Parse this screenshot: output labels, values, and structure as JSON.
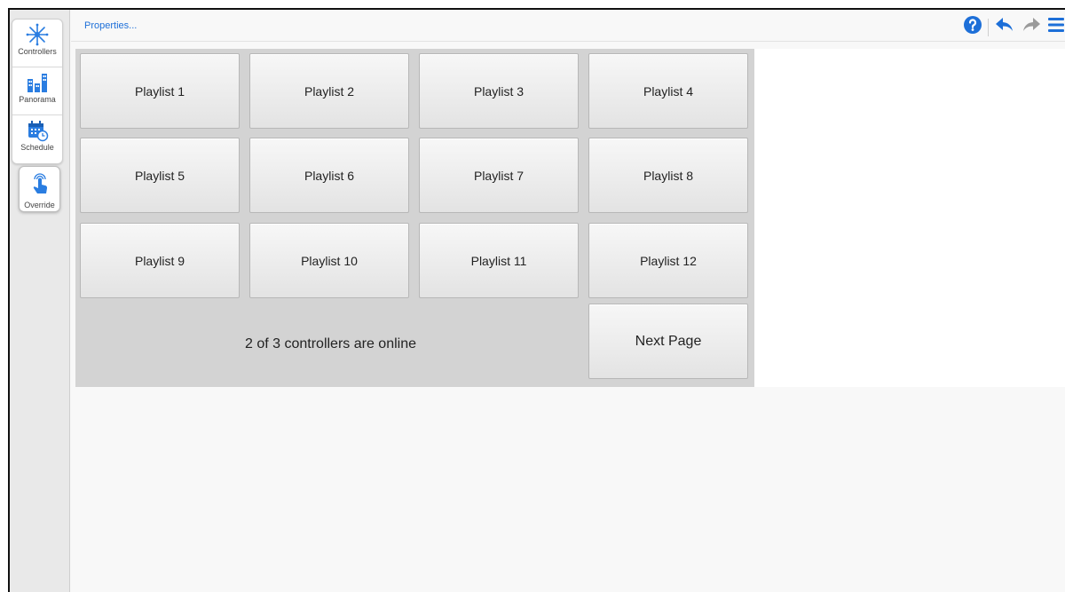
{
  "sidebar": {
    "items": [
      {
        "label": "Controllers",
        "icon": "starburst-icon"
      },
      {
        "label": "Panorama",
        "icon": "panorama-icon"
      },
      {
        "label": "Schedule",
        "icon": "calendar-clock-icon"
      },
      {
        "label": "Override",
        "icon": "touch-hand-icon"
      }
    ]
  },
  "topbar": {
    "properties_label": "Properties...",
    "icons": [
      "help-icon",
      "undo-icon",
      "redo-icon",
      "menu-icon"
    ]
  },
  "playlists": [
    "Playlist 1",
    "Playlist 2",
    "Playlist 3",
    "Playlist 4",
    "Playlist 5",
    "Playlist 6",
    "Playlist 7",
    "Playlist 8",
    "Playlist 9",
    "Playlist 10",
    "Playlist 11",
    "Playlist 12"
  ],
  "status_text": "2 of 3 controllers are online",
  "next_page_label": "Next Page",
  "colors": {
    "accent": "#1d6fd8",
    "panel": "#d3d3d3"
  }
}
